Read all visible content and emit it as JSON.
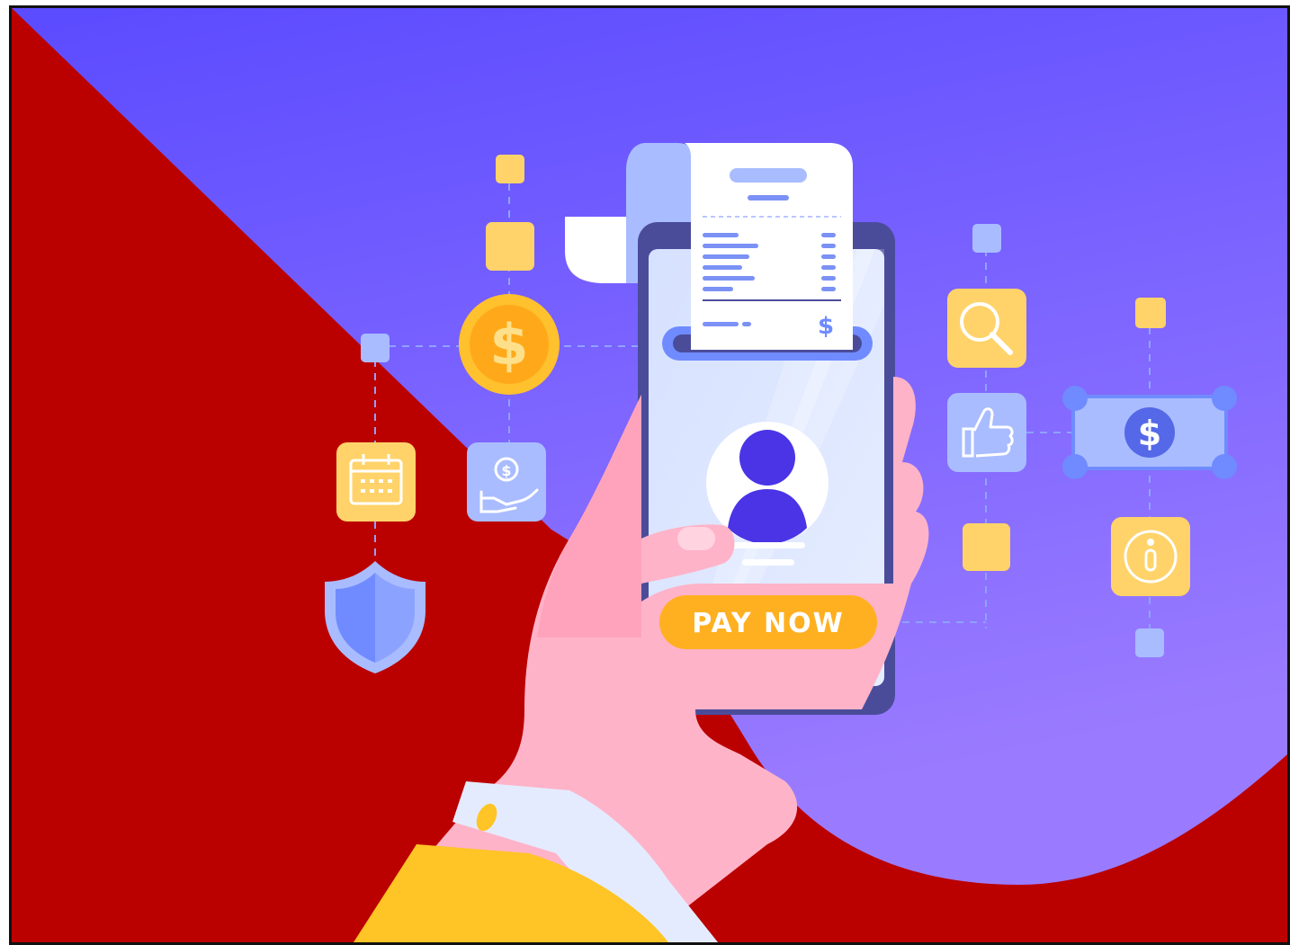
{
  "button": {
    "pay_label": "PAY NOW"
  },
  "receipt": {
    "currency_symbol": "$"
  },
  "coin": {
    "symbol": "$"
  },
  "banknote": {
    "symbol": "$"
  },
  "colors": {
    "background_red": "#BB0000",
    "background_purple_top": "#5B4BFF",
    "background_purple_bottom": "#9A7BFF",
    "accent_yellow": "#FFD36A",
    "coin_gold": "#FFC12E",
    "accent_blue": "#A9BCFF",
    "phone_frame": "#4A4C9A",
    "phone_screen": "#DCE6FF",
    "avatar_purple": "#4A34E6",
    "hand_pink": "#FFB3C8",
    "sleeve_yellow": "#FFC425",
    "cuff": "#E5EBFF",
    "button_orange": "#FFB020"
  },
  "icons": [
    "coin-dollar-icon",
    "calendar-icon",
    "hand-coin-icon",
    "shield-icon",
    "search-icon",
    "thumbs-up-icon",
    "banknote-dollar-icon",
    "info-icon",
    "user-avatar-icon"
  ]
}
